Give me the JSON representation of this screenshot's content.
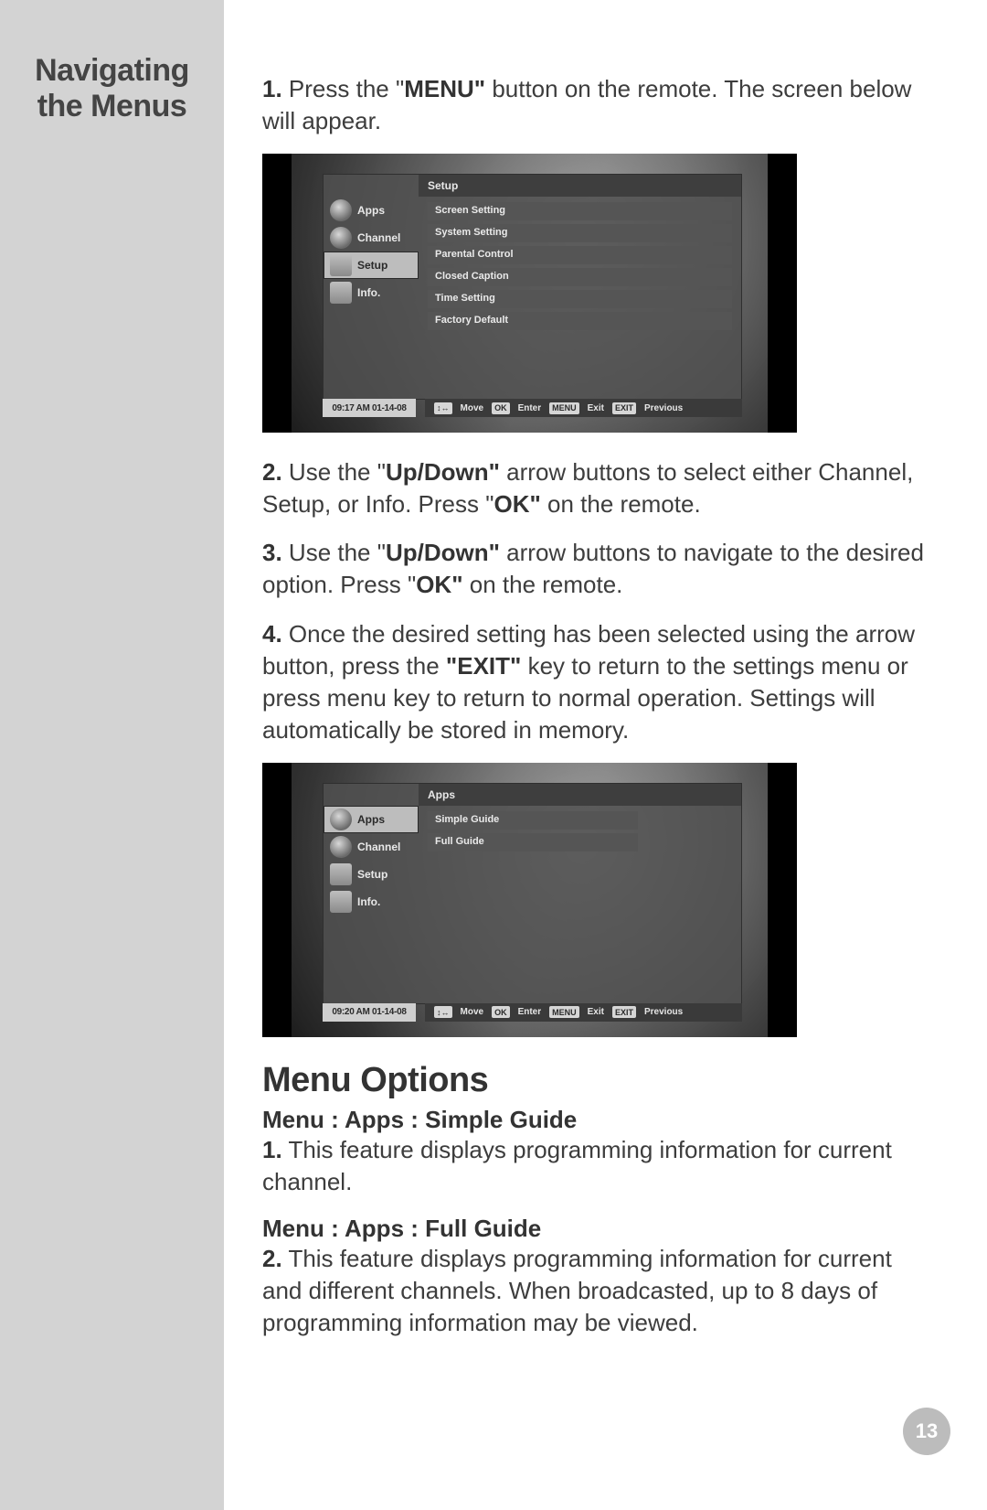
{
  "sidebar": {
    "title_line1": "Navigating",
    "title_line2": "the Menus"
  },
  "steps": {
    "s1a": "1.",
    "s1b": " Press the \"",
    "s1c": "MENU\"",
    "s1d": " button on the remote. The screen below will appear.",
    "s2a": "2.",
    "s2b": " Use the \"",
    "s2c": "Up/Down\"",
    "s2d": " arrow buttons to select either Channel, Setup, or Info. Press \"",
    "s2e": "OK\"",
    "s2f": " on the remote.",
    "s3a": "3.",
    "s3b": " Use the \"",
    "s3c": "Up/Down\"",
    "s3d": " arrow buttons to navigate to the desired option. Press \"",
    "s3e": "OK\"",
    "s3f": " on the remote.",
    "s4a": "4.",
    "s4b": " Once the desired setting has been selected using the arrow button, press the ",
    "s4c": "\"EXIT\"",
    "s4d": " key to return to the settings menu or press menu key to return to normal operation. Settings will automatically be stored in memory."
  },
  "tv1": {
    "title": "Setup",
    "tabs": [
      "Apps",
      "Channel",
      "Setup",
      "Info."
    ],
    "selected_tab": 2,
    "options": [
      "Screen Setting",
      "System Setting",
      "Parental Control",
      "Closed Caption",
      "Time Setting",
      "Factory Default"
    ],
    "time": "09:17 AM 01-14-08",
    "hints": {
      "move_key": "↕↔",
      "move": "Move",
      "ok_key": "OK",
      "ok": "Enter",
      "menu_key": "MENU",
      "menu": "Exit",
      "exit_key": "EXIT",
      "exit": "Previous"
    }
  },
  "tv2": {
    "title": "Apps",
    "tabs": [
      "Apps",
      "Channel",
      "Setup",
      "Info."
    ],
    "selected_tab": 0,
    "options": [
      "Simple Guide",
      "Full Guide"
    ],
    "time": "09:20 AM 01-14-08",
    "hints": {
      "move_key": "↕↔",
      "move": "Move",
      "ok_key": "OK",
      "ok": "Enter",
      "menu_key": "MENU",
      "menu": "Exit",
      "exit_key": "EXIT",
      "exit": "Previous"
    }
  },
  "menu_options": {
    "heading": "Menu Options",
    "sub1": "Menu  :  Apps  :  Simple Guide",
    "p1a": "1.",
    "p1b": " This feature  displays programming information for current channel.",
    "sub2": "Menu  :  Apps  :  Full Guide",
    "p2a": "2.",
    "p2b": " This feature displays programming information for current and different channels. When broadcasted, up to 8 days of programming information may be viewed."
  },
  "page_number": "13"
}
